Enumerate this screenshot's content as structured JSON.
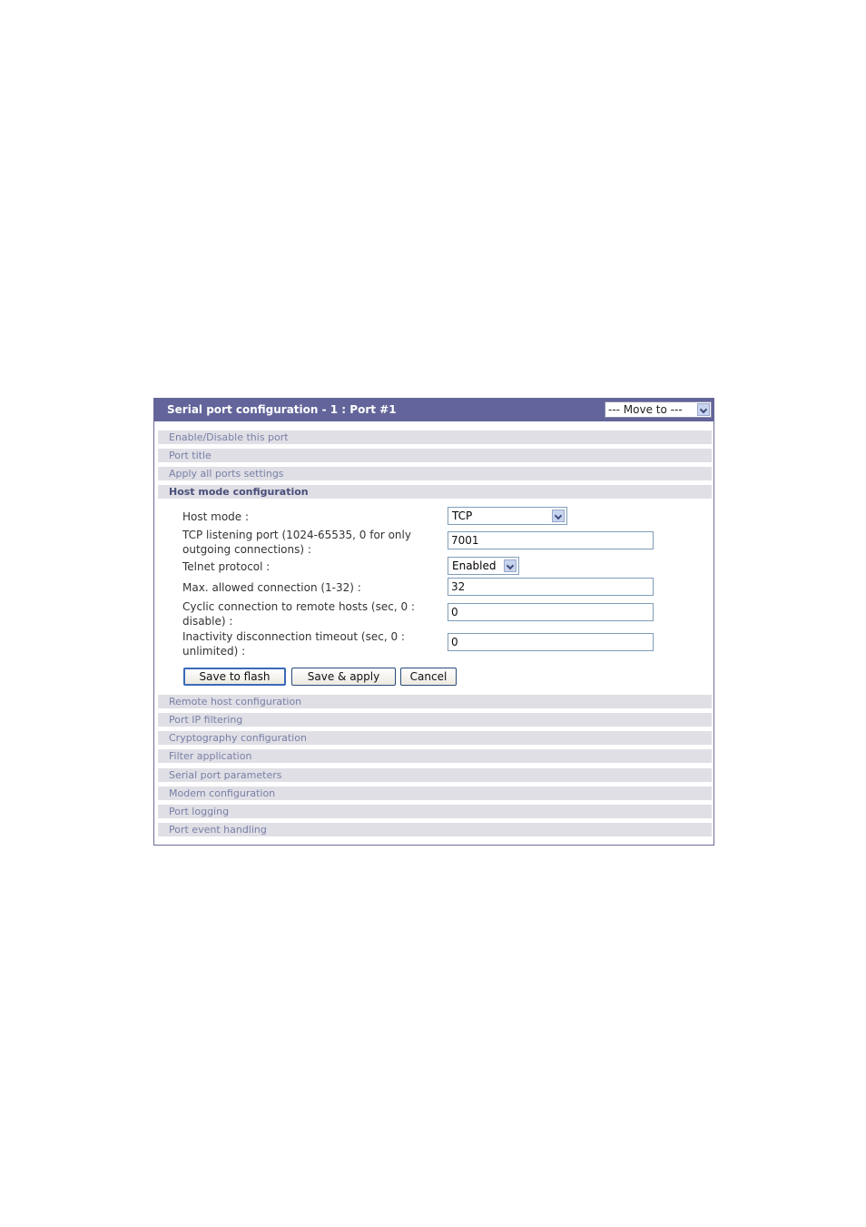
{
  "panel": {
    "title": "Serial port configuration - 1 : Port #1",
    "move_to": "--- Move to ---"
  },
  "sections_top": [
    {
      "label": "Enable/Disable this port"
    },
    {
      "label": "Port title"
    },
    {
      "label": "Apply all ports settings"
    },
    {
      "label": "Host mode configuration"
    }
  ],
  "form": {
    "host_mode": {
      "label": "Host mode :",
      "value": "TCP"
    },
    "tcp_port": {
      "label_line1": "TCP listening port (1024-65535, 0 for only",
      "label_line2": "outgoing connections) :",
      "value": "7001"
    },
    "telnet": {
      "label": "Telnet protocol :",
      "value": "Enabled"
    },
    "max_conn": {
      "label": "Max. allowed connection (1-32) :",
      "value": "32"
    },
    "cyclic": {
      "label_line1": "Cyclic connection to remote hosts (sec, 0 :",
      "label_line2": "disable) :",
      "value": "0"
    },
    "inactivity": {
      "label_line1": "Inactivity disconnection timeout (sec, 0 :",
      "label_line2": "unlimited) :",
      "value": "0"
    }
  },
  "buttons": {
    "save_flash": "Save to flash",
    "save_apply": "Save & apply",
    "cancel": "Cancel"
  },
  "sections_bottom": [
    {
      "label": "Remote host configuration"
    },
    {
      "label": "Port IP filtering"
    },
    {
      "label": "Cryptography configuration"
    },
    {
      "label": "Filter application"
    },
    {
      "label": "Serial port parameters"
    },
    {
      "label": "Modem configuration"
    },
    {
      "label": "Port logging"
    },
    {
      "label": "Port event handling"
    }
  ]
}
